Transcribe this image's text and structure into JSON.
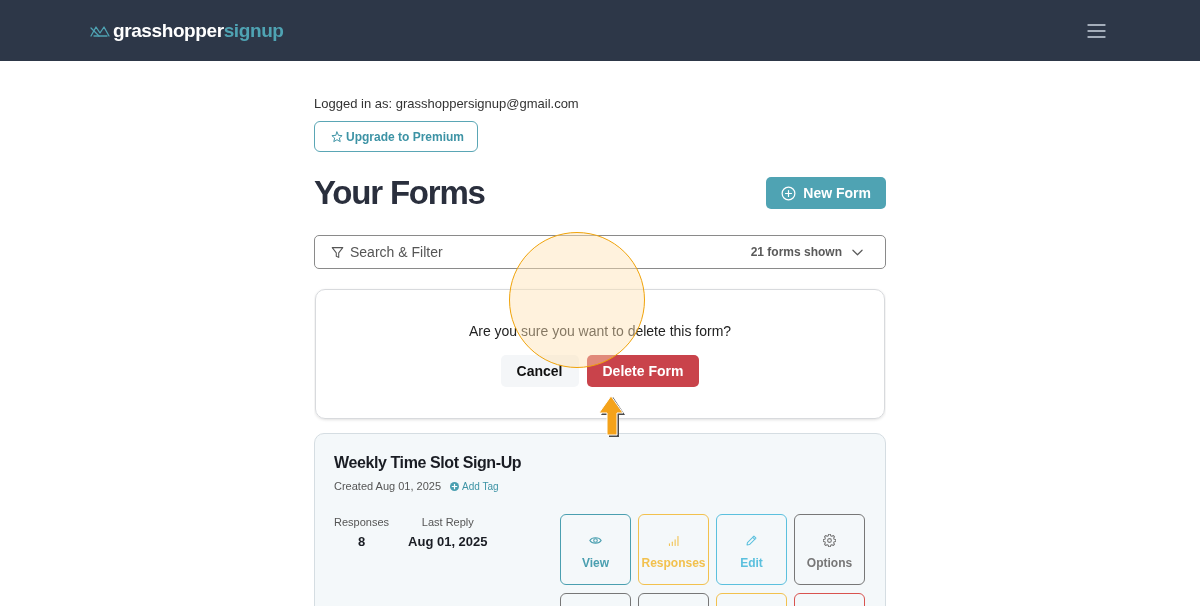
{
  "header": {
    "logo": {
      "primary": "grasshopper",
      "accent": "signup"
    }
  },
  "account": {
    "logged_in": "Logged in as: grasshoppersignup@gmail.com",
    "upgrade_button": "Upgrade to Premium"
  },
  "page": {
    "title": "Your Forms",
    "new_button": "New Form"
  },
  "search": {
    "label": "Search & Filter",
    "count": "21 forms shown",
    "expanded": false
  },
  "confirm_dialog": {
    "message": "Are you sure you want to delete this form?",
    "buttons": [
      {
        "label": "Cancel",
        "kind": "secondary"
      },
      {
        "label": "Delete Form",
        "kind": "danger"
      }
    ]
  },
  "forms": [
    {
      "title": "Weekly Time Slot Sign-Up",
      "created": "Created Aug 01, 2025",
      "add_tag": "Add Tag",
      "stats": [
        {
          "label": "Responses",
          "value": "8"
        },
        {
          "label": "Last Reply",
          "value": "Aug 01, 2025"
        }
      ],
      "actions": [
        {
          "label": "View",
          "kind": "view",
          "color": "#4a9fb0"
        },
        {
          "label": "Responses",
          "kind": "responses",
          "color": "#f2c14e"
        },
        {
          "label": "Edit",
          "kind": "edit",
          "color": "#5bc0de"
        },
        {
          "label": "Options",
          "kind": "options",
          "color": "#777777"
        }
      ],
      "more_actions": [
        {
          "color": "#777777"
        },
        {
          "color": "#777777"
        },
        {
          "color": "#f2c14e"
        },
        {
          "color": "#d9534f"
        }
      ]
    }
  ]
}
